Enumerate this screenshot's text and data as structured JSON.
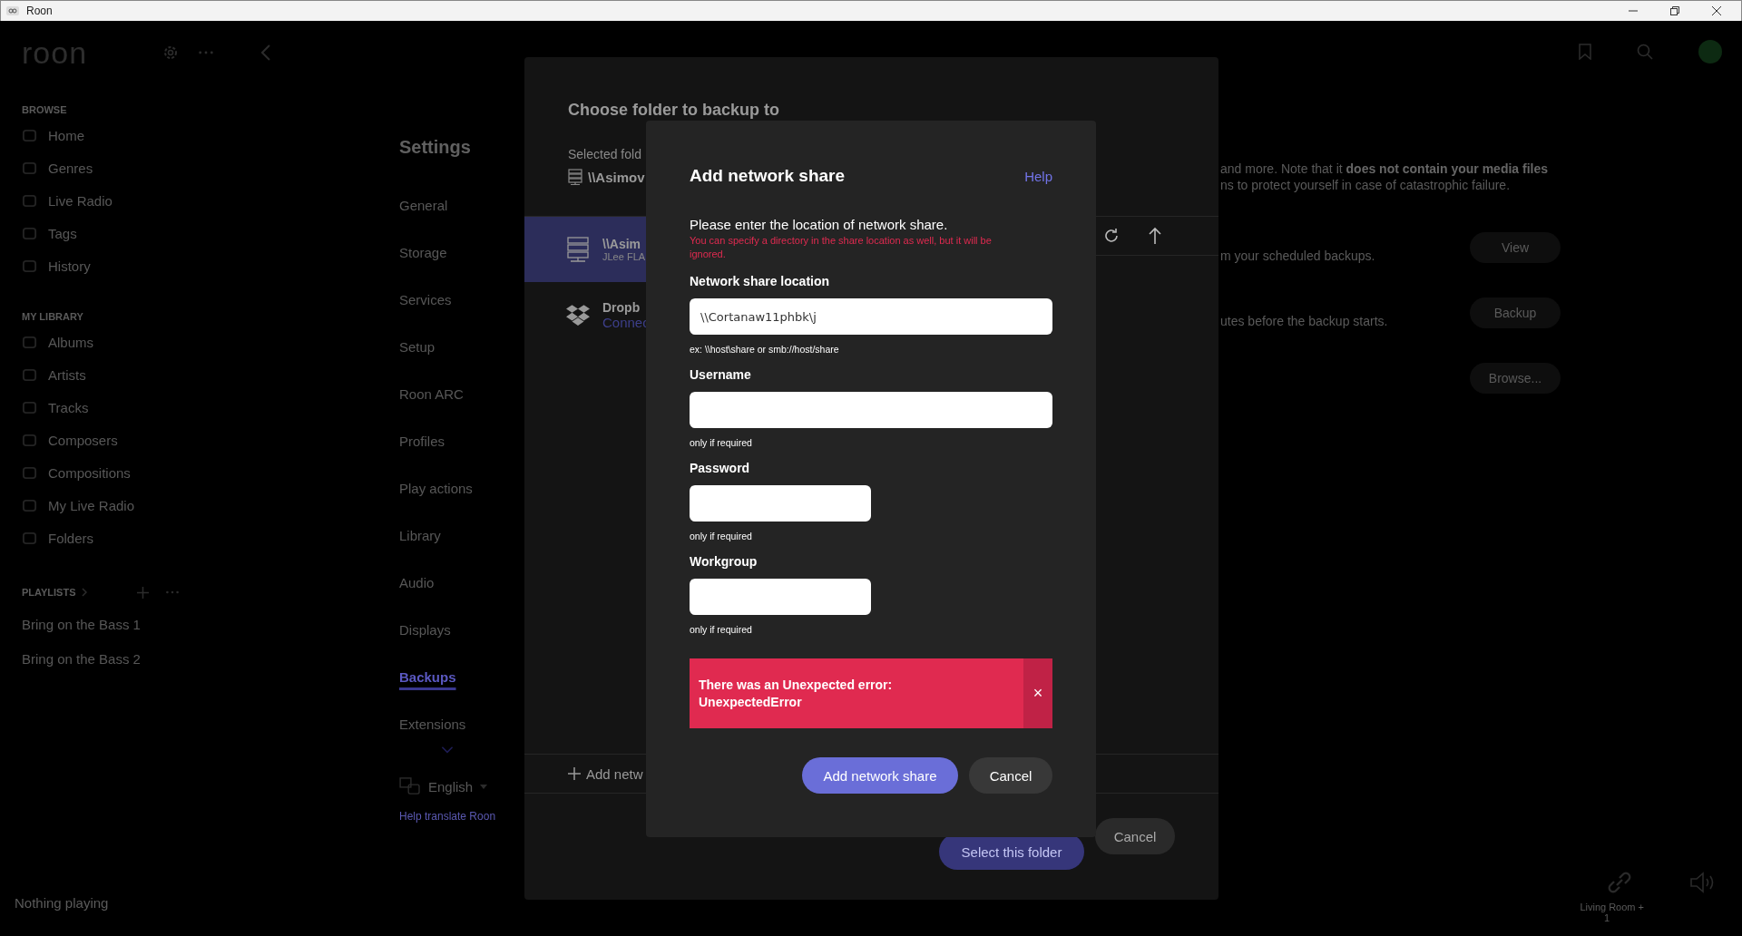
{
  "window": {
    "title": "Roon"
  },
  "header": {
    "logo": "roon"
  },
  "sidebar": {
    "sections": [
      {
        "title": "BROWSE",
        "items": [
          "Home",
          "Genres",
          "Live Radio",
          "Tags",
          "History"
        ]
      },
      {
        "title": "MY LIBRARY",
        "items": [
          "Albums",
          "Artists",
          "Tracks",
          "Composers",
          "Compositions",
          "My Live Radio",
          "Folders"
        ]
      }
    ],
    "playlists": {
      "title": "PLAYLISTS",
      "items": [
        "Bring on the Bass 1",
        "Bring on the Bass 2"
      ]
    },
    "now_playing": "Nothing playing"
  },
  "settings": {
    "title": "Settings",
    "items": [
      {
        "label": "General",
        "selected": false
      },
      {
        "label": "Storage",
        "selected": false
      },
      {
        "label": "Services",
        "selected": false
      },
      {
        "label": "Setup",
        "selected": false
      },
      {
        "label": "Roon ARC",
        "selected": false
      },
      {
        "label": "Profiles",
        "selected": false
      },
      {
        "label": "Play actions",
        "selected": false
      },
      {
        "label": "Library",
        "selected": false
      },
      {
        "label": "Audio",
        "selected": false
      },
      {
        "label": "Displays",
        "selected": false
      },
      {
        "label": "Backups",
        "selected": true
      },
      {
        "label": "Extensions",
        "selected": false
      }
    ],
    "language": "English",
    "translate_link": "Help translate Roon"
  },
  "backups": {
    "description": [
      "and more. Note that it **does not contain your media files**",
      "ns to protect yourself in case of catastrophic failure."
    ],
    "rows": [
      {
        "text": "m your scheduled backups.",
        "button": "View"
      },
      {
        "text": "utes before the backup starts.",
        "button": "Backup"
      },
      {
        "button": "Browse..."
      }
    ]
  },
  "zone": {
    "name": "Living Room +",
    "count": "1"
  },
  "folder_dialog": {
    "title": "Choose folder to backup to",
    "selected_label": "Selected fold",
    "selected_path": "\\\\Asimov",
    "locations": [
      {
        "name": "\\\\Asim",
        "detail": "JLee FLA",
        "kind": "server",
        "selected": true
      },
      {
        "name": "Dropb",
        "detail": "Connec",
        "kind": "dropbox",
        "selected": false
      }
    ],
    "add_link": "Add netw",
    "select_button": "Select this folder",
    "cancel_button": "Cancel"
  },
  "share_dialog": {
    "title": "Add network share",
    "help": "Help",
    "intro": "Please enter the location of network share.",
    "warning": "You can specify a directory in the share location as well, but it will be ignored.",
    "fields": [
      {
        "label": "Network share location",
        "value": "\\\\Cortanaw11phbk\\j",
        "hint": "ex: \\\\host\\share or smb://host/share",
        "kind": "wide"
      },
      {
        "label": "Username",
        "hint": "only if required",
        "kind": "wide"
      },
      {
        "label": "Password",
        "hint": "only if required",
        "kind": "short"
      },
      {
        "label": "Workgroup",
        "hint": "only if required",
        "kind": "short"
      }
    ],
    "error": "There was an Unexpected error: UnexpectedError",
    "close": "×",
    "add_button": "Add network share",
    "cancel_button": "Cancel"
  }
}
